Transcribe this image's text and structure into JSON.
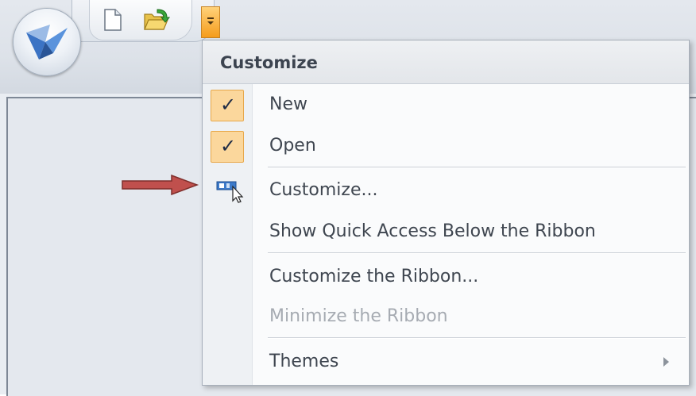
{
  "menu": {
    "title": "Customize",
    "items": {
      "new": {
        "label": "New",
        "checked": true
      },
      "open": {
        "label": "Open",
        "checked": true
      },
      "customize": {
        "label": "Customize..."
      },
      "show_below": {
        "label": "Show Quick Access Below the Ribbon"
      },
      "customize_ribbon": {
        "label": "Customize the Ribbon..."
      },
      "minimize_ribbon": {
        "label": "Minimize the Ribbon",
        "disabled": true
      },
      "themes": {
        "label": "Themes",
        "has_submenu": true
      }
    }
  },
  "icons": {
    "app_orb": "application-orb-icon",
    "new": "new-document-icon",
    "open": "open-folder-icon",
    "qat_dropdown": "chevron-down-icon",
    "customize": "customize-icon",
    "pointer": "red-arrow-icon"
  },
  "colors": {
    "accent": "#f59c1c",
    "check_highlight": "#fbd79c",
    "arrow": "#c0504d"
  }
}
